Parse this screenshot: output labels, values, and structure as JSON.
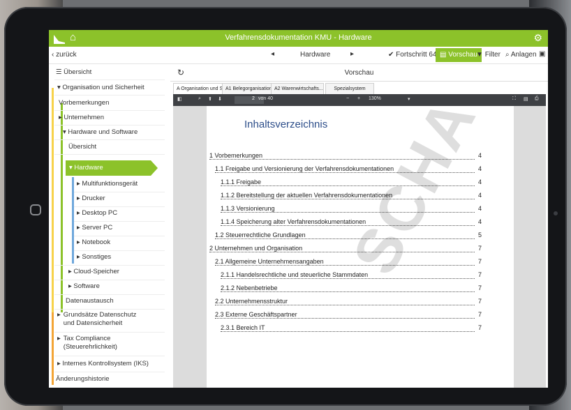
{
  "app": {
    "title": "Verfahrensdokumentation KMU - Hardware"
  },
  "nav": {
    "back_label": "zurück",
    "breadcrumb": "Hardware",
    "progress_label": "Fortschritt 64%",
    "progress_value": 64,
    "preview_label": "Vorschau",
    "filter_label": "Filter",
    "attachments_label": "Anlagen"
  },
  "sidebar": {
    "items": [
      {
        "label": "Übersicht"
      },
      {
        "label": "Organisation und Sicherheit"
      },
      {
        "label": "Vorbemerkungen"
      },
      {
        "label": "Unternehmen"
      },
      {
        "label": "Hardware und Software"
      },
      {
        "label": "Übersicht"
      },
      {
        "label": "Hardware"
      },
      {
        "label": "Multifunktionsgerät"
      },
      {
        "label": "Drucker"
      },
      {
        "label": "Desktop PC"
      },
      {
        "label": "Server PC"
      },
      {
        "label": "Notebook"
      },
      {
        "label": "Sonstiges"
      },
      {
        "label": "Cloud-Speicher"
      },
      {
        "label": "Software"
      },
      {
        "label": "Datenaustausch"
      },
      {
        "label": "Grundsätze Datenschutz und Datensicherheit"
      },
      {
        "label": "Tax Compliance (Steuerehrlichkeit)"
      },
      {
        "label": "Internes Kontrollsystem (IKS)"
      },
      {
        "label": "Änderungshistorie"
      }
    ]
  },
  "preview": {
    "title": "Vorschau",
    "tabs": [
      {
        "label": "A Organisation und S..."
      },
      {
        "label": "A1 Belegorganisation..."
      },
      {
        "label": "A2 Warenwirtschafts..."
      },
      {
        "label": "Spezialsystem"
      }
    ],
    "toolbar": {
      "page_current": "2",
      "page_total_label": "von 40",
      "zoom": "130%"
    },
    "document": {
      "heading": "Inhaltsverzeichnis",
      "watermark": "SCHAU",
      "toc": [
        {
          "text": "1 Vorbemerkungen",
          "page": "4"
        },
        {
          "text": "1.1 Freigabe und Versionierung der Verfahrensdokumentationen",
          "page": "4"
        },
        {
          "text": "1.1.1 Freigabe",
          "page": "4"
        },
        {
          "text": "1.1.2 Bereitstellung der aktuellen Verfahrensdokumentationen",
          "page": "4"
        },
        {
          "text": "1.1.3 Versionierung",
          "page": "4"
        },
        {
          "text": "1.1.4 Speicherung alter Verfahrensdokumentationen",
          "page": "4"
        },
        {
          "text": "1.2 Steuerrechtliche Grundlagen",
          "page": "5"
        },
        {
          "text": "2 Unternehmen und Organisation",
          "page": "7"
        },
        {
          "text": "2.1 Allgemeine Unternehmensangaben",
          "page": "7"
        },
        {
          "text": "2.1.1 Handelsrechtliche und steuerliche Stammdaten",
          "page": "7"
        },
        {
          "text": "2.1.2 Nebenbetriebe",
          "page": "7"
        },
        {
          "text": "2.2 Unternehmensstruktur",
          "page": "7"
        },
        {
          "text": "2.3 Externe Geschäftspartner",
          "page": "7"
        },
        {
          "text": "2.3.1 Bereich IT",
          "page": "7"
        }
      ]
    }
  },
  "colors": {
    "accent": "#8cc22a",
    "bar_orange": "#f3a536",
    "bar_yellow": "#f7d24a",
    "bar_green": "#8cc22a",
    "bar_blue": "#6fa8dc",
    "toolbar": "#3e4044"
  }
}
